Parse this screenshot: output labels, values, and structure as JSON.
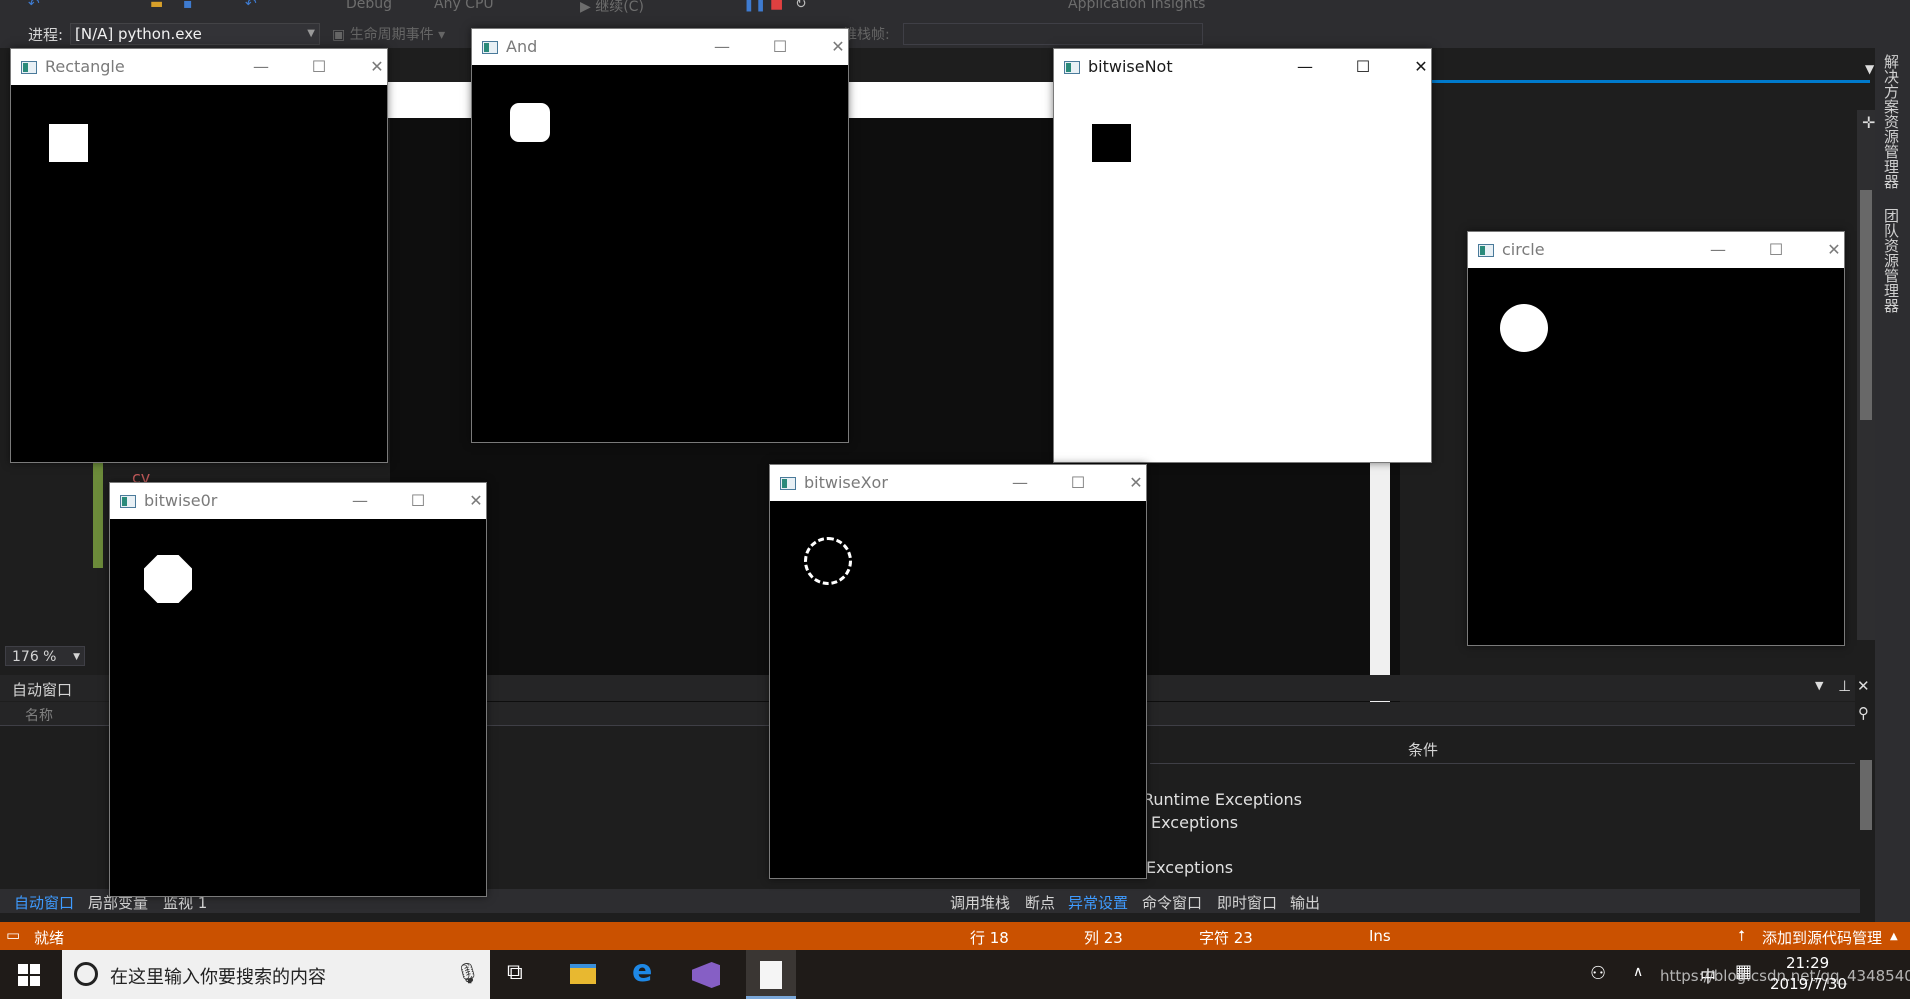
{
  "toolbar": {
    "config": "Debug",
    "platform": "Any CPU",
    "continue_label": "继续(C)",
    "insights": "Application Insights"
  },
  "process_bar": {
    "label": "进程:",
    "process_value": "[N/A] python.exe",
    "lifecycle_events": "生命周期事件",
    "stack_frame": "堆栈帧:"
  },
  "editor": {
    "zoom": "176 %",
    "code_fragment": "cv"
  },
  "right_panel": {
    "solution_explorer": "解决方案资源管理器",
    "team_explorer": "团队资源管理器"
  },
  "autos": {
    "title": "自动窗口",
    "col_name": "名称",
    "col_condition": "条件"
  },
  "exceptions": [
    "Runtime Exceptions",
    "Exceptions",
    "Exceptions"
  ],
  "bottom_tabs_left": [
    "自动窗口",
    "局部变量",
    "监视 1"
  ],
  "bottom_tabs_right": [
    "调用堆栈",
    "断点",
    "异常设置",
    "命令窗口",
    "即时窗口",
    "输出"
  ],
  "status": {
    "ready": "就绪",
    "line": "行 18",
    "col": "列 23",
    "char": "字符 23",
    "ins": "Ins",
    "source_control": "添加到源代码管理"
  },
  "taskbar": {
    "search_placeholder": "在这里输入你要搜索的内容",
    "time": "21:29",
    "date": "2019/7/30",
    "ime": "中",
    "url": "https://blog.csdn.net/qq_43485409"
  },
  "windows": [
    {
      "id": "rectangle",
      "title": "Rectangle",
      "bg": "black",
      "shape": "square"
    },
    {
      "id": "and",
      "title": "And",
      "bg": "black",
      "shape": "rounded-square"
    },
    {
      "id": "bitwisenot",
      "title": "bitwiseNot",
      "bg": "white",
      "shape": "black-square"
    },
    {
      "id": "circle",
      "title": "circle",
      "bg": "black",
      "shape": "circle"
    },
    {
      "id": "bitwiseor",
      "title": "bitwise0r",
      "bg": "black",
      "shape": "octagon-circle"
    },
    {
      "id": "bitwisexor",
      "title": "bitwiseXor",
      "bg": "black",
      "shape": "ring-corners"
    }
  ],
  "colors": {
    "vs_background": "#1e1e1e",
    "status_orange": "#ca5100",
    "accent_blue": "#007acc"
  }
}
